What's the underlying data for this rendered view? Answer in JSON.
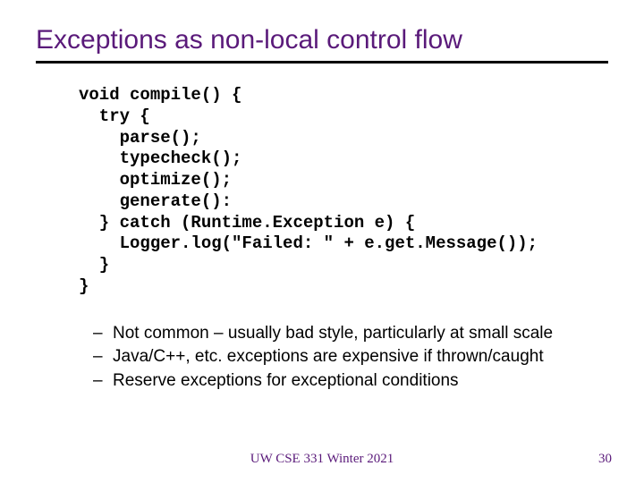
{
  "title": "Exceptions as non-local control flow",
  "code": {
    "l1": "void compile() {",
    "l2": "  try {",
    "l3": "    parse();",
    "l4": "    typecheck();",
    "l5": "    optimize();",
    "l6": "    generate():",
    "l7": "  } catch (Runtime.Exception e) {",
    "l8": "    Logger.log(\"Failed: \" + e.get.Message());",
    "l9": "  }",
    "l10": "}"
  },
  "bullets": [
    "Not common – usually bad style, particularly at small scale",
    "Java/C++, etc. exceptions are expensive if thrown/caught",
    "Reserve exceptions for exceptional conditions"
  ],
  "footer": "UW CSE 331 Winter 2021",
  "pagenum": "30"
}
